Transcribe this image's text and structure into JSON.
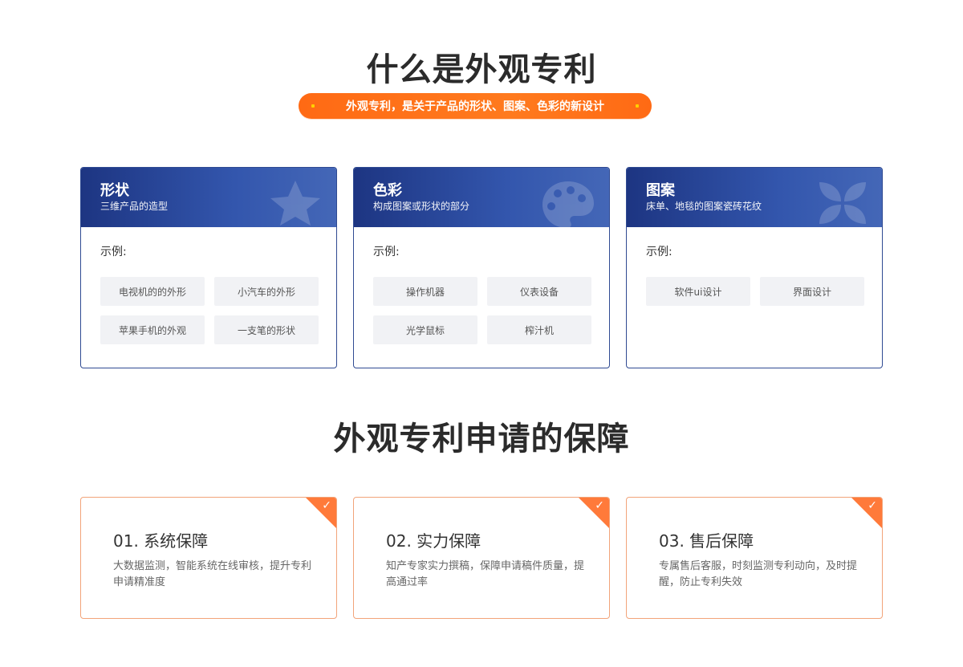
{
  "section1": {
    "title": "什么是外观专利",
    "banner": "外观专利，是关于产品的形状、图案、色彩的新设计"
  },
  "cards": [
    {
      "title": "形状",
      "subtitle": "三维产品的造型",
      "icon": "star-icon",
      "example_label": "示例:",
      "chips": [
        "电视机的的外形",
        "小汽车的外形",
        "苹果手机的外观",
        "一支笔的形状"
      ]
    },
    {
      "title": "色彩",
      "subtitle": "构成图案或形状的部分",
      "icon": "palette-icon",
      "example_label": "示例:",
      "chips": [
        "操作机器",
        "仪表设备",
        "光学鼠标",
        "榨汁机"
      ]
    },
    {
      "title": "图案",
      "subtitle": "床单、地毯的图案瓷砖花纹",
      "icon": "pattern-icon",
      "example_label": "示例:",
      "chips": [
        "软件ui设计",
        "界面设计"
      ]
    }
  ],
  "section2": {
    "title": "外观专利申请的保障"
  },
  "features": [
    {
      "title": "01. 系统保障",
      "desc": "大数据监测，智能系统在线审核，提升专利申请精准度",
      "icon": "check-icon"
    },
    {
      "title": "02. 实力保障",
      "desc": "知产专家实力撰稿，保障申请稿件质量，提高通过率",
      "icon": "check-icon"
    },
    {
      "title": "03. 售后保障",
      "desc": "专属售后客服，时刻监测专利动向，及时提醒，防止专利失效",
      "icon": "check-icon"
    }
  ],
  "colors": {
    "accent_orange": "#ff6a14",
    "card_blue": "#1d3582",
    "feature_border": "#f2a47a"
  }
}
